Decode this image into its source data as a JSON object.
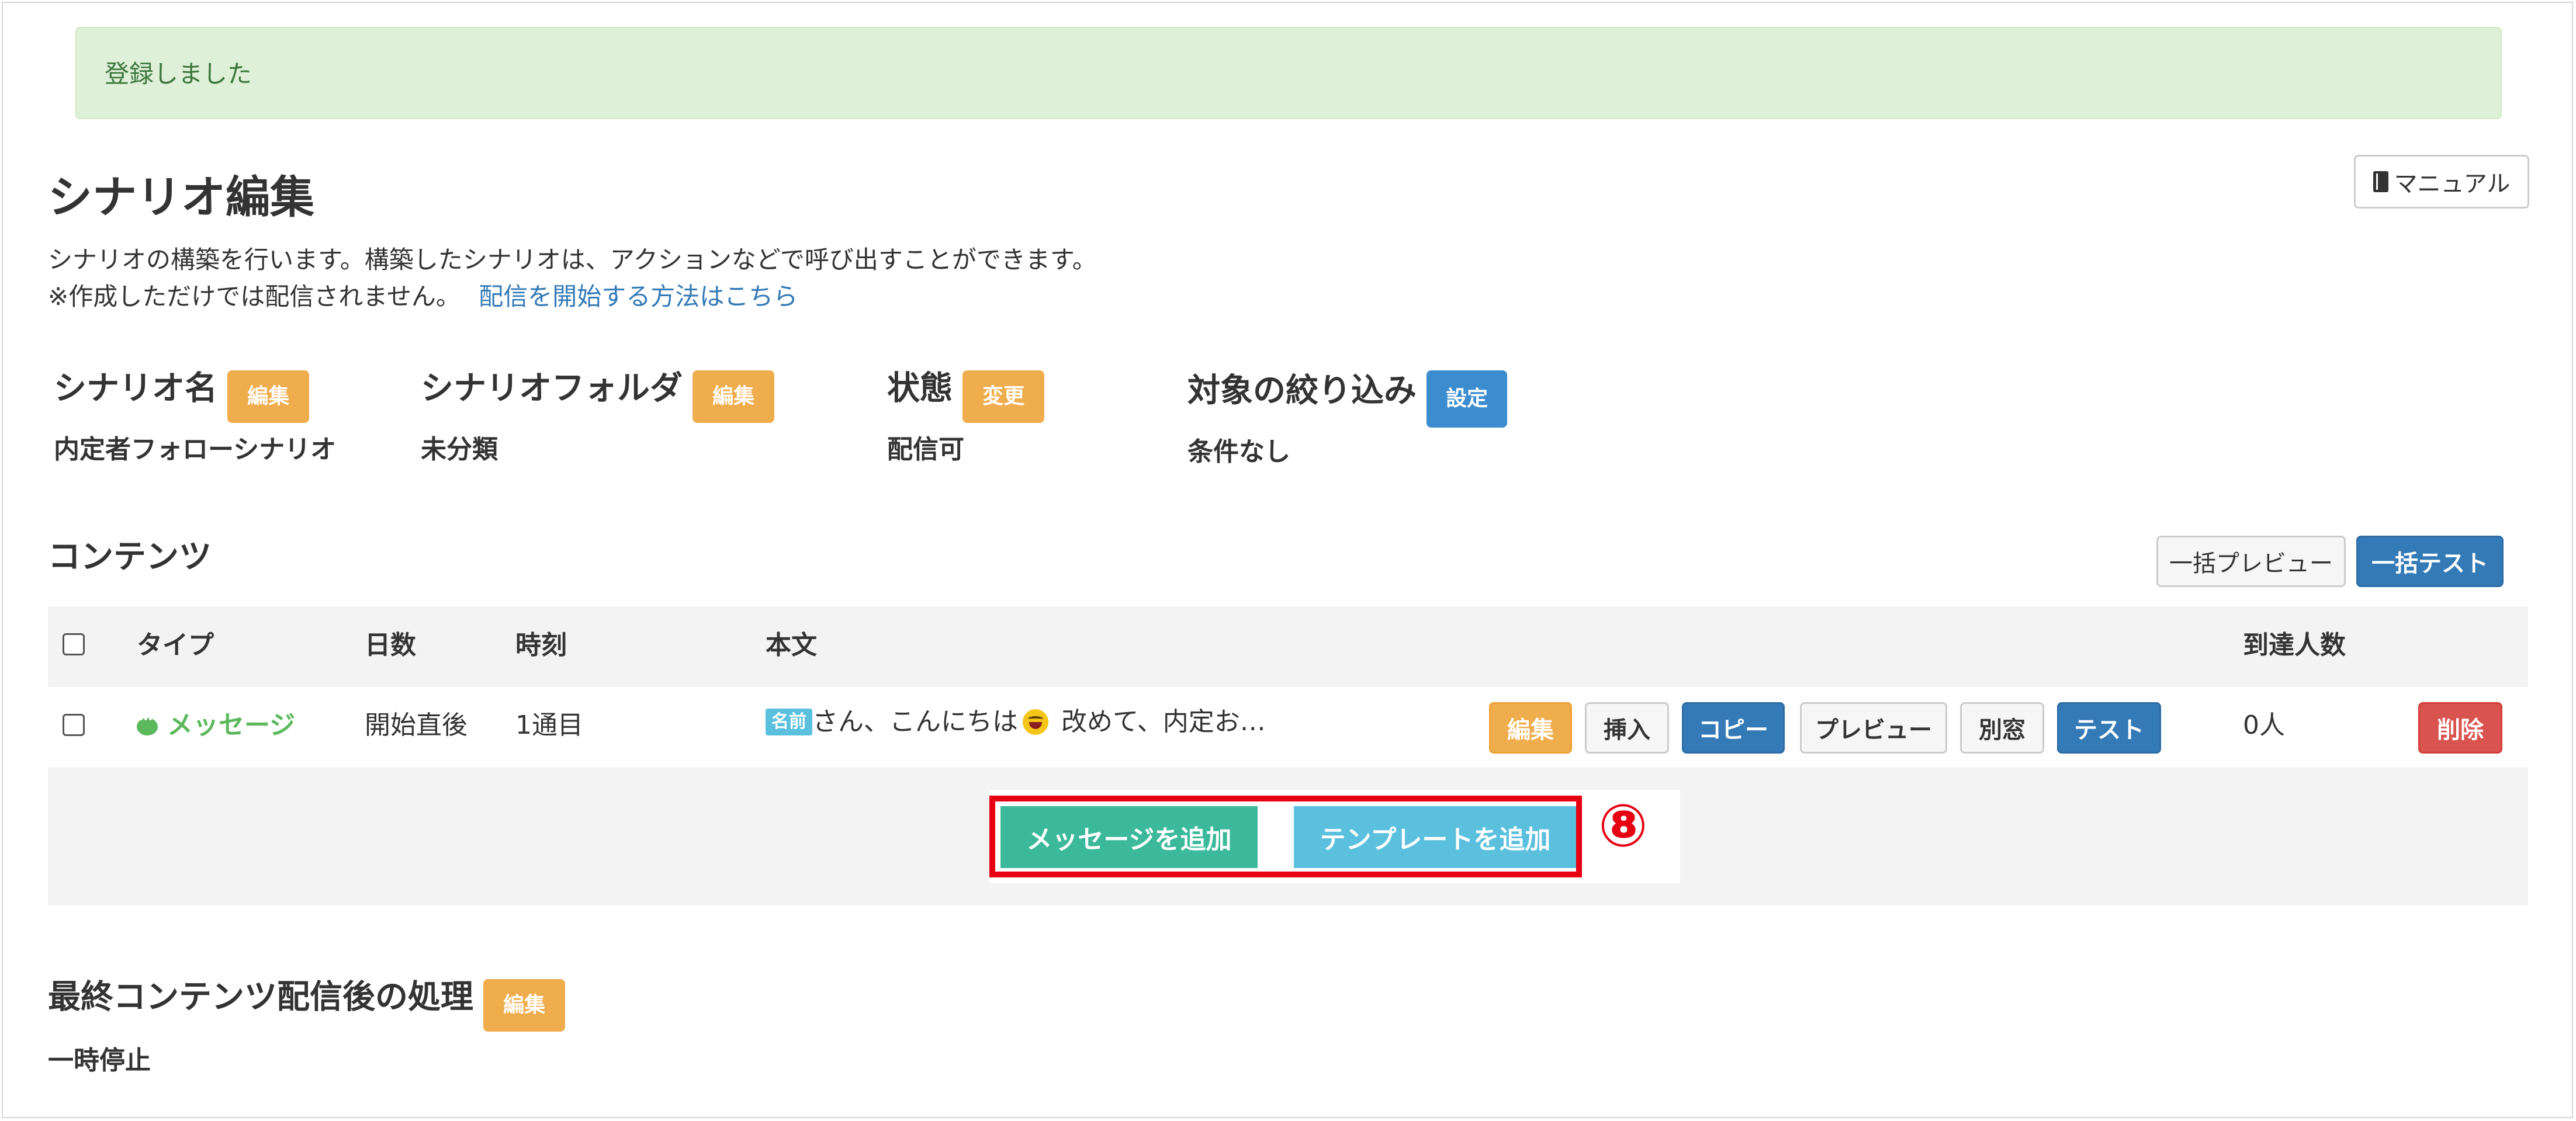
{
  "alert": {
    "message": "登録しました"
  },
  "header": {
    "manual_label": "マニュアル",
    "title": "シナリオ編集",
    "description": "シナリオの構築を行います。構築したシナリオは、アクションなどで呼び出すことができます。",
    "note": "※作成しただけでは配信されません。",
    "note_link": "配信を開始する方法はこちら"
  },
  "settings": {
    "scenario_name": {
      "label": "シナリオ名",
      "button": "編集",
      "value": "内定者フォローシナリオ"
    },
    "folder": {
      "label": "シナリオフォルダ",
      "button": "編集",
      "value": "未分類"
    },
    "status": {
      "label": "状態",
      "button": "変更",
      "value": "配信可"
    },
    "filter": {
      "label": "対象の絞り込み",
      "button": "設定",
      "value": "条件なし"
    }
  },
  "contents": {
    "title": "コンテンツ",
    "bulk_preview": "一括プレビュー",
    "bulk_test": "一括テスト",
    "columns": {
      "type": "タイプ",
      "days": "日数",
      "time": "時刻",
      "body": "本文",
      "reach": "到達人数"
    },
    "rows": [
      {
        "type": "メッセージ",
        "days": "開始直後",
        "time": "1通目",
        "name_badge": "名前",
        "body_before": "さん、こんにちは",
        "body_after": " 改めて、内定お…",
        "reach": "0人",
        "actions": {
          "edit": "編集",
          "insert": "挿入",
          "copy": "コピー",
          "preview": "プレビュー",
          "new_window": "別窓",
          "test": "テスト",
          "delete": "削除"
        }
      }
    ],
    "add_message": "メッセージを追加",
    "add_template": "テンプレートを追加",
    "marker": "⑧"
  },
  "final": {
    "label": "最終コンテンツ配信後の処理",
    "button": "編集",
    "value": "一時停止"
  },
  "colors": {
    "alert_bg": "#dff0d8",
    "primary": "#337ab7",
    "warning": "#f0ad4e",
    "danger": "#d9534f",
    "success": "#3cb99b",
    "info": "#5bc0de",
    "highlight": "#e60012"
  },
  "icons": {
    "manual": "book-icon",
    "message": "chat-bubble-icon",
    "emoji": "laughing-face-emoji"
  }
}
